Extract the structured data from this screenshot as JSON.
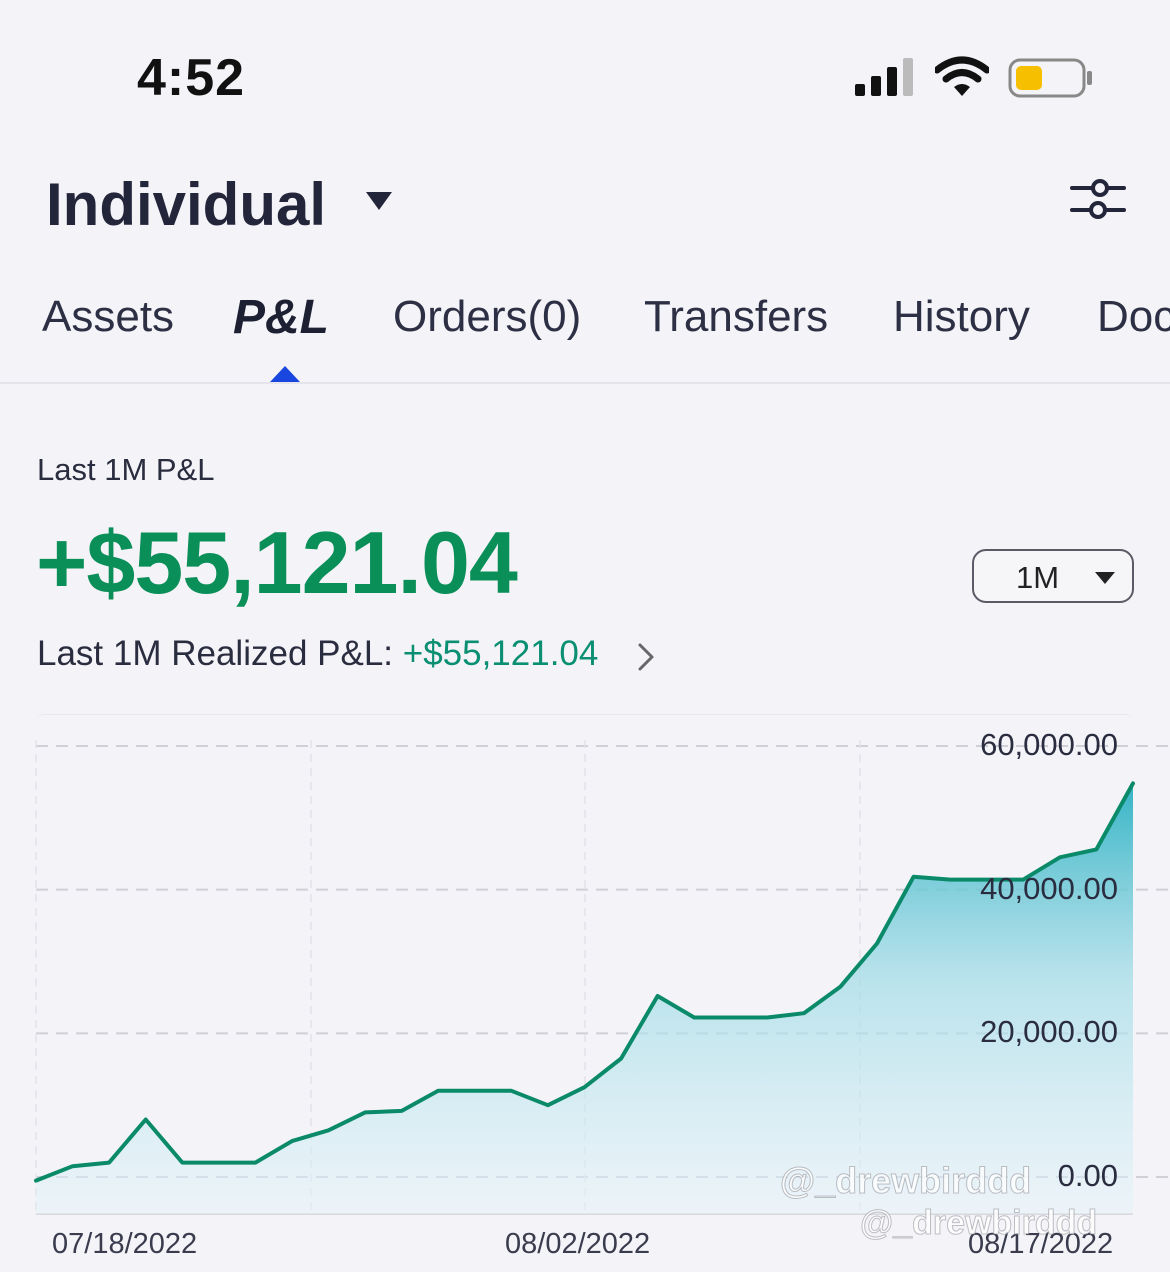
{
  "status_bar": {
    "time": "4:52",
    "icons": [
      "signal-icon",
      "wifi-icon",
      "battery-icon"
    ],
    "battery_color": "#f6c000"
  },
  "header": {
    "account_title": "Individual",
    "dropdown_icon": "caret-down-icon",
    "settings_icon": "sliders-icon"
  },
  "tabs": [
    {
      "label": "Assets",
      "active": false
    },
    {
      "label": "P&L",
      "active": true
    },
    {
      "label": "Orders(0)",
      "active": false
    },
    {
      "label": "Transfers",
      "active": false
    },
    {
      "label": "History",
      "active": false
    },
    {
      "label": "Doc",
      "active": false
    }
  ],
  "summary": {
    "label": "Last 1M P&L",
    "value": "+$55,121.04",
    "period": "1M",
    "realized_label": "Last 1M Realized P&L: ",
    "realized_value": "+$55,121.04"
  },
  "colors": {
    "positive": "#0b8f59",
    "line": "#0b8a6a",
    "active_indicator": "#1a46e0"
  },
  "chart_data": {
    "type": "area",
    "y_ticks": [
      "60,000.00",
      "40,000.00",
      "20,000.00",
      "0.00"
    ],
    "x_ticks": [
      "07/18/2022",
      "08/02/2022",
      "08/17/2022"
    ],
    "ylim": [
      0,
      60000
    ],
    "grid": true,
    "series": [
      {
        "values": [
          -500,
          1500,
          2000,
          8000,
          2000,
          2000,
          2000,
          5000,
          6500,
          9000,
          9200,
          12000,
          12000,
          12000,
          10000,
          12500,
          16500,
          25200,
          22200,
          22200,
          22200,
          22800,
          26500,
          32500,
          41800,
          41400,
          41400,
          41400,
          44500,
          45600,
          54800
        ]
      }
    ]
  },
  "watermarks": [
    "@_drewbirddd",
    "@_drewbirddd"
  ]
}
